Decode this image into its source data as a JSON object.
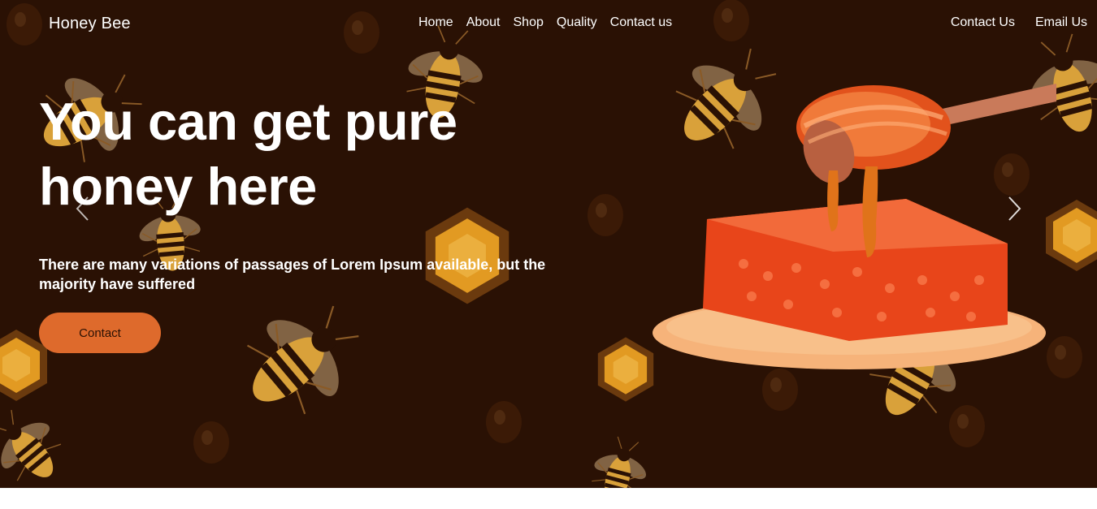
{
  "nav": {
    "brand": "Honey Bee",
    "links": [
      "Home",
      "About",
      "Shop",
      "Quality",
      "Contact us"
    ],
    "right_links": [
      "Contact Us",
      "Email Us"
    ]
  },
  "hero": {
    "headline_line1": "You can get pure",
    "headline_line2": "honey here",
    "subtext": "There are many variations of passages of Lorem Ipsum available, but the majority have suffered",
    "cta_label": "Contact"
  },
  "icons": {
    "prev": "chevron-left-icon",
    "next": "chevron-right-icon"
  },
  "colors": {
    "background": "#2a1104",
    "accent": "#de6a2c",
    "text": "#ffffff"
  }
}
